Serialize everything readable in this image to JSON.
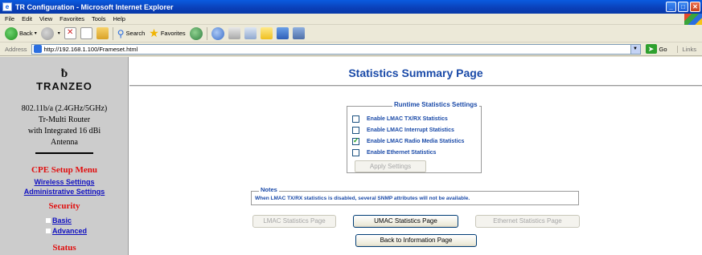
{
  "window": {
    "title": "TR Configuration - Microsoft Internet Explorer",
    "controls": [
      "_",
      "□",
      "✕"
    ]
  },
  "menubar": {
    "items": [
      "File",
      "Edit",
      "View",
      "Favorites",
      "Tools",
      "Help"
    ]
  },
  "toolbar": {
    "back_label": "Back",
    "search_label": "Search",
    "favorites_label": "Favorites"
  },
  "addressbar": {
    "label": "Address",
    "url": "http://192.168.1.100/Frameset.html",
    "go_label": "Go",
    "links_label": "Links"
  },
  "sidebar": {
    "logo_mark": "ƀ",
    "logo_text": "TRANZEO",
    "device_lines": [
      "802.11b/a (2.4GHz/5GHz)",
      "Tr-Multi Router",
      "with Integrated 16 dBi",
      "Antenna"
    ],
    "menu_title": "CPE Setup Menu",
    "wireless_settings": "Wireless Settings",
    "administrative_settings": "Administrative Settings",
    "security_title": "Security",
    "security_basic": "Basic",
    "security_advanced": "Advanced",
    "status_title": "Status"
  },
  "main": {
    "title": "Statistics Summary Page",
    "settings": {
      "legend": "Runtime Statistics Settings",
      "options": [
        {
          "label": "Enable LMAC TX/RX Statistics",
          "checked": false
        },
        {
          "label": "Enable LMAC Interrupt Statistics",
          "checked": false
        },
        {
          "label": "Enable LMAC Radio Media Statistics",
          "checked": true
        },
        {
          "label": "Enable Ethernet Statistics",
          "checked": false
        }
      ],
      "apply_label": "Apply Settings"
    },
    "notes": {
      "legend": "Notes",
      "text": "When LMAC TX/RX statistics is disabled, several SNMP attributes will not be available."
    },
    "buttons": {
      "lmac": "LMAC Statistics Page",
      "umac": "UMAC Statistics Page",
      "ethernet": "Ethernet Statistics Page",
      "back": "Back to Information Page"
    }
  }
}
